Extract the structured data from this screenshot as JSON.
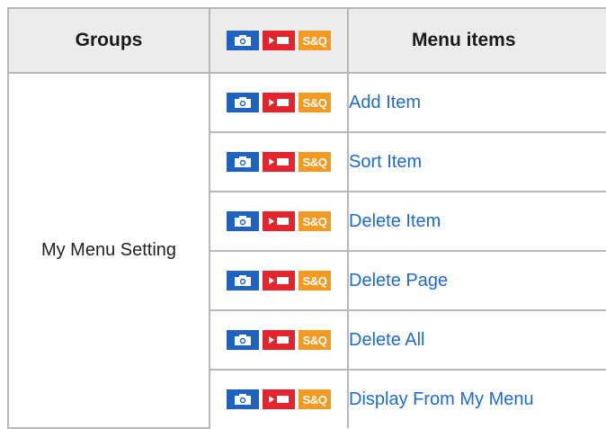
{
  "table": {
    "headers": {
      "groups": "Groups",
      "menu_items": "Menu items"
    },
    "group_name": "My Menu Setting",
    "mode_icons": {
      "photo": "camera-icon",
      "movie": "movie-icon",
      "sq_label": "S&Q"
    },
    "colors": {
      "photo": "#1e63bf",
      "movie": "#e4242d",
      "sq": "#f29a22",
      "link": "#1c6bd2",
      "header_bg": "#ececec",
      "border": "#b8b8b8"
    },
    "items": [
      {
        "label": "Add Item"
      },
      {
        "label": "Sort Item"
      },
      {
        "label": "Delete Item"
      },
      {
        "label": "Delete Page"
      },
      {
        "label": "Delete All"
      },
      {
        "label": "Display From My Menu"
      }
    ]
  }
}
